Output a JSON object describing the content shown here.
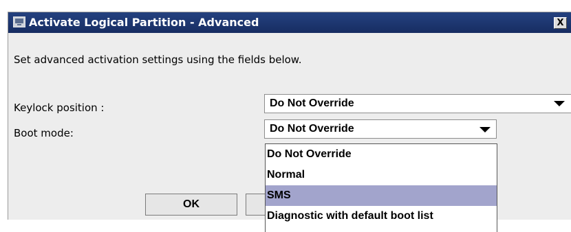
{
  "window": {
    "title": "Activate Logical Partition - Advanced",
    "close_label": "X"
  },
  "instructions": "Set advanced activation settings using the fields below.",
  "fields": {
    "keylock": {
      "label": "Keylock position :",
      "value": "Do Not Override"
    },
    "boot_mode": {
      "label": "Boot mode:",
      "value": "Do Not Override",
      "options": [
        "Do Not Override",
        "Normal",
        "SMS",
        "Diagnostic with default boot list"
      ],
      "highlighted_option": "SMS"
    }
  },
  "buttons": {
    "ok_label": "OK"
  },
  "colors": {
    "titlebar": "#1f3a74",
    "highlight": "#a2a4cc",
    "dialog_background": "#ededed"
  }
}
